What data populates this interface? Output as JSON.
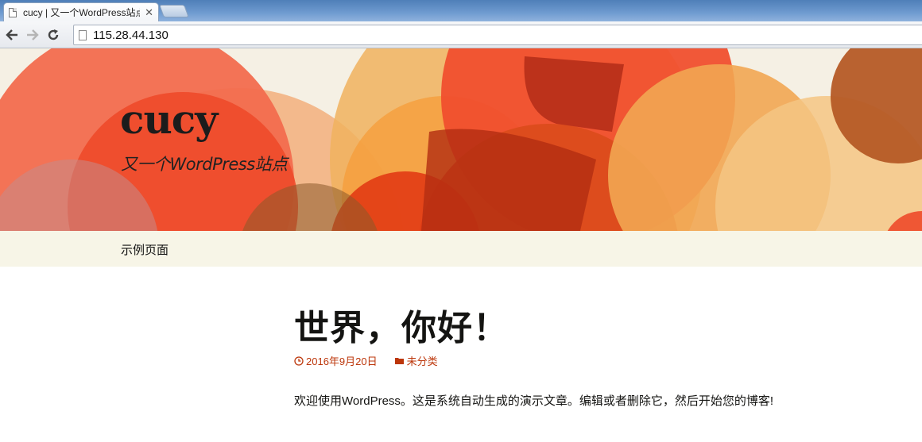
{
  "browser": {
    "tab_title": "cucy | 又一个WordPress站点",
    "url": "115.28.44.130"
  },
  "site": {
    "title": "cucy",
    "tagline": "又一个WordPress站点"
  },
  "nav": {
    "items": [
      {
        "label": "示例页面"
      }
    ]
  },
  "post": {
    "title": "世界，你好！",
    "date": "2016年9月20日",
    "category": "未分类",
    "body": "欢迎使用WordPress。这是系统自动生成的演示文章。编辑或者删除它，然后开始您的博客!"
  },
  "colors": {
    "link": "#bc360a",
    "header_bg": "#f5f0e4",
    "nav_bg": "#f7f5e7"
  },
  "icons": [
    "page-icon",
    "back-icon",
    "forward-icon",
    "reload-icon",
    "close-icon",
    "clock-icon",
    "folder-icon"
  ]
}
